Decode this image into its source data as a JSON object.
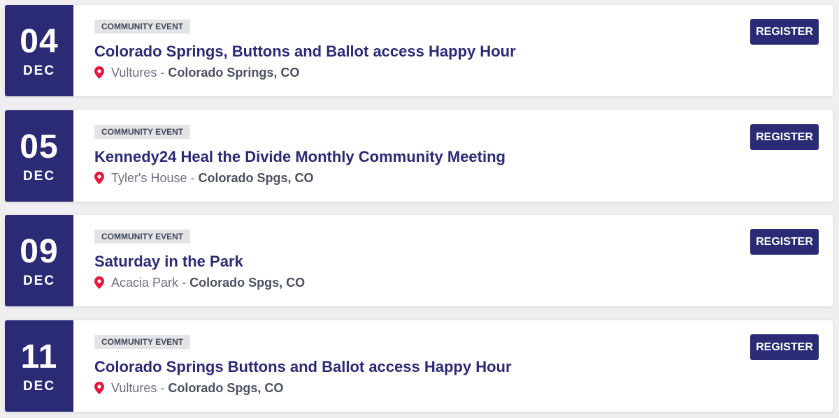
{
  "colors": {
    "brand": "#2b2a74",
    "pin": "#e5173f",
    "badge_bg": "#e3e4e8",
    "background": "#efeff1"
  },
  "events": [
    {
      "day": "04",
      "month": "DEC",
      "badge": "COMMUNITY EVENT",
      "title": "Colorado Springs, Buttons and Ballot access Happy Hour",
      "venue": "Vultures",
      "separator": "-",
      "city": "Colorado Springs, CO",
      "button_label": "REGISTER",
      "pin_icon": "map-pin-icon"
    },
    {
      "day": "05",
      "month": "DEC",
      "badge": "COMMUNITY EVENT",
      "title": "Kennedy24 Heal the Divide Monthly Community Meeting",
      "venue": "Tyler's House",
      "separator": "-",
      "city": "Colorado Spgs, CO",
      "button_label": "REGISTER",
      "pin_icon": "map-pin-icon"
    },
    {
      "day": "09",
      "month": "DEC",
      "badge": "COMMUNITY EVENT",
      "title": "Saturday in the Park",
      "venue": "Acacia Park",
      "separator": "-",
      "city": "Colorado Spgs, CO",
      "button_label": "REGISTER",
      "pin_icon": "map-pin-icon"
    },
    {
      "day": "11",
      "month": "DEC",
      "badge": "COMMUNITY EVENT",
      "title": "Colorado Springs Buttons and Ballot access Happy Hour",
      "venue": "Vultures",
      "separator": "-",
      "city": "Colorado Spgs, CO",
      "button_label": "REGISTER",
      "pin_icon": "map-pin-icon"
    }
  ]
}
